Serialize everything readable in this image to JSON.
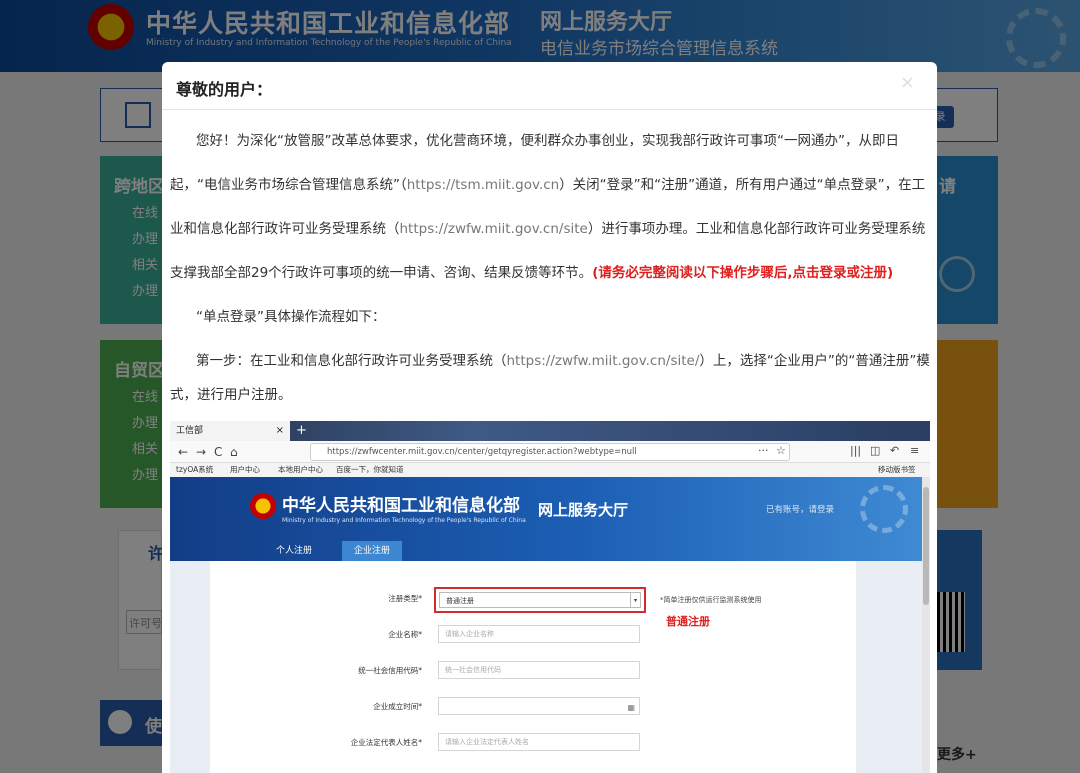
{
  "background": {
    "ministry_title": "中华人民共和国工业和信息化部",
    "ministry_subtitle": "Ministry of Industry and Information Technology of the People's Republic of China",
    "hall_title": "网上服务大厅",
    "system_title": "电信业务市场综合管理信息系统",
    "search_button": "录",
    "tile_cross_region": {
      "title": "跨地区",
      "lines": [
        "在线",
        "办理",
        "相关",
        "办理"
      ]
    },
    "tile_ftz": {
      "title": "自贸区",
      "lines": [
        "在线",
        "办理",
        "相关",
        "办理"
      ]
    },
    "tile_right_top": "请",
    "license_title": "许",
    "license_input_placeholder": "许可号",
    "use_title": "使",
    "more_link": "更多+"
  },
  "modal": {
    "title": "尊敬的用户：",
    "close_label": "×",
    "paragraphs": [
      {
        "pre": "您好！为深化“放管服”改革总体要求，优化营商环境，便利群众办事创业，实现我部行政许可事项“一网通办”，从即日"
      },
      {
        "pre": "起，“电信业务市场综合管理信息系统”（",
        "url": "https://tsm.miit.gov.cn",
        "post": "）关闭“登录”和“注册”通道，所有用户通过“单点登录”，在工"
      },
      {
        "pre": "业和信息化部行政许可业务受理系统（",
        "url": "https://zwfw.miit.gov.cn/site",
        "post": "）进行事项办理。工业和信息化部行政许可业务受理系统"
      },
      {
        "pre": "支撑我部全部29个行政许可事项的统一申请、咨询、结果反馈等环节。",
        "warn": "(请务必完整阅读以下操作步骤后,点击登录或注册)"
      },
      {
        "pre": "“单点登录”具体操作流程如下："
      },
      {
        "pre": "第一步：在工业和信息化部行政许可业务受理系统（",
        "url": "https://zwfw.miit.gov.cn/site/",
        "post": "）上，选择“企业用户”的“普通注册”模"
      },
      {
        "pre": "式，进行用户注册。"
      }
    ]
  },
  "screenshot": {
    "tab_title": "工信部",
    "tab_close": "×",
    "new_tab": "+",
    "nav": {
      "back": "←",
      "forward": "→",
      "reload": "C",
      "home": "⌂"
    },
    "url": "https://zwfwcenter.miit.gov.cn/center/getqyregister.action?webtype=null",
    "toolbar_right": [
      "···",
      "☆",
      "|||",
      "◫",
      "↶",
      "≡"
    ],
    "bookmarks": [
      "tzyOA系统",
      "用户中心",
      "本地用户中心",
      "百度一下，你就知道",
      "移动版书签"
    ],
    "banner_title": "中华人民共和国工业和信息化部",
    "banner_subtitle": "Ministry of Industry and Information Technology of the People's Republic of China",
    "banner_hall": "网上服务大厅",
    "banner_login": "已有账号，请登录",
    "tabs": [
      "个人注册",
      "企业注册"
    ],
    "form": {
      "register_type_label": "注册类型*",
      "register_type_value": "普通注册",
      "register_type_note": "*简单注册仅供运行监测系统使用",
      "callout": "普通注册",
      "rows": [
        {
          "label": "企业名称*",
          "placeholder": "请输入企业名称"
        },
        {
          "label": "统一社会信用代码*",
          "placeholder": "统一社会信用代码"
        },
        {
          "label": "企业成立时间*",
          "placeholder": ""
        },
        {
          "label": "企业法定代表人姓名*",
          "placeholder": "请输入企业法定代表人姓名"
        }
      ],
      "calendar_icon": "▦"
    }
  }
}
